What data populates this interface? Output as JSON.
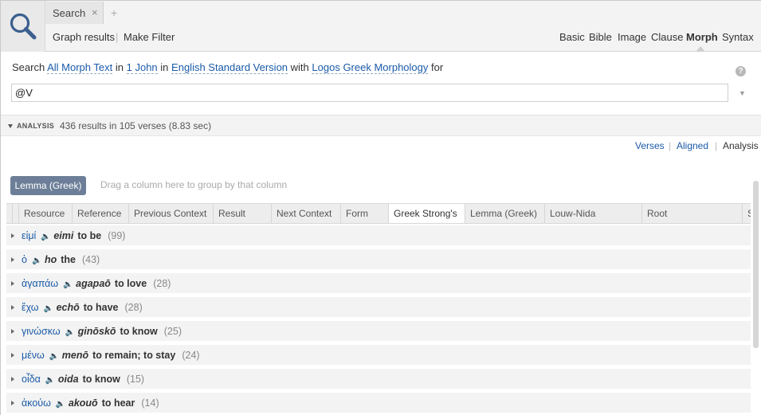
{
  "tab": {
    "title": "Search",
    "close": "×",
    "new": "+"
  },
  "toolbar": {
    "graph_results": "Graph results",
    "make_filter": "Make Filter",
    "separator": "|"
  },
  "modes": [
    "Basic",
    "Bible",
    "Image",
    "Clause",
    "Morph",
    "Syntax"
  ],
  "active_mode": "Morph",
  "query": {
    "prefix": "Search",
    "scope": "All Morph Text",
    "in1": "in",
    "book": "1 John",
    "in2": "in",
    "version": "English Standard Version",
    "with": "with",
    "morphology": "Logos Greek Morphology",
    "for": "for",
    "input_value": "@V",
    "help": "?",
    "input_caret": "▼"
  },
  "analysis": {
    "label": "ANALYSIS",
    "stats": "436 results in 105 verses (8.83 sec)"
  },
  "views": {
    "verses": "Verses",
    "aligned": "Aligned",
    "analysis": "Analysis",
    "sep": "|"
  },
  "grouping": {
    "chip": "Lemma (Greek)",
    "hint": "Drag a column here to group by that column"
  },
  "columns": [
    "Resource",
    "Reference",
    "Previous Context",
    "Result",
    "Next Context",
    "Form",
    "Greek Strong's",
    "Lemma (Greek)",
    "Louw-Nida",
    "Root",
    "S"
  ],
  "active_column": "Greek Strong's",
  "speaker_icon": "🔈",
  "rows": [
    {
      "greek": "εἰμί",
      "translit": "eimi",
      "gloss": "to be",
      "count": "(99)"
    },
    {
      "greek": "ὁ",
      "translit": "ho",
      "gloss": "the",
      "count": "(43)"
    },
    {
      "greek": "ἀγαπάω",
      "translit": "agapaō",
      "gloss": "to love",
      "count": "(28)"
    },
    {
      "greek": "ἔχω",
      "translit": "echō",
      "gloss": "to have",
      "count": "(28)"
    },
    {
      "greek": "γινώσκω",
      "translit": "ginōskō",
      "gloss": "to know",
      "count": "(25)"
    },
    {
      "greek": "μένω",
      "translit": "menō",
      "gloss": "to remain; to stay",
      "count": "(24)"
    },
    {
      "greek": "οἶδα",
      "translit": "oida",
      "gloss": "to know",
      "count": "(15)"
    },
    {
      "greek": "ἀκούω",
      "translit": "akouō",
      "gloss": "to hear",
      "count": "(14)"
    }
  ]
}
